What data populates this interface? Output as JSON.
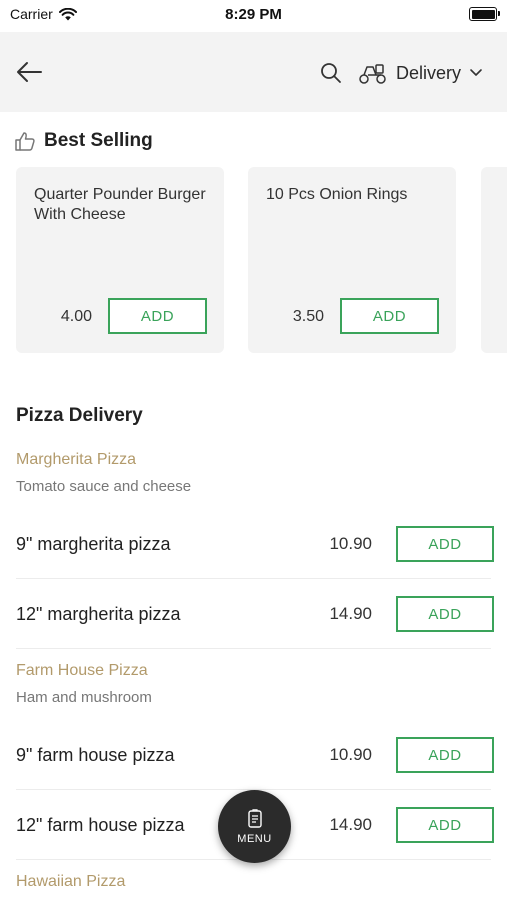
{
  "status_bar": {
    "carrier": "Carrier",
    "time": "8:29 PM"
  },
  "header": {
    "back_icon": "arrow-left-icon",
    "search_icon": "search-icon",
    "delivery_icon": "scooter-icon",
    "delivery_label": "Delivery",
    "chevron_icon": "chevron-down-icon"
  },
  "best_selling": {
    "title": "Best Selling",
    "icon": "thumbs-up-icon",
    "cards": [
      {
        "name": "Quarter Pounder Burger With Cheese",
        "price": "4.00",
        "add_label": "ADD"
      },
      {
        "name": "10 Pcs Onion Rings",
        "price": "3.50",
        "add_label": "ADD"
      }
    ]
  },
  "menu": {
    "section_title": "Pizza Delivery",
    "categories": [
      {
        "title": "Margherita Pizza",
        "description": "Tomato sauce and cheese",
        "items": [
          {
            "name": "9\" margherita pizza",
            "price": "10.90",
            "add_label": "ADD"
          },
          {
            "name": "12\" margherita pizza",
            "price": "14.90",
            "add_label": "ADD"
          }
        ]
      },
      {
        "title": "Farm House Pizza",
        "description": "Ham and mushroom",
        "items": [
          {
            "name": "9\" farm house pizza",
            "price": "10.90",
            "add_label": "ADD"
          },
          {
            "name": "12\" farm house pizza",
            "price": "14.90",
            "add_label": "ADD"
          }
        ]
      },
      {
        "title": "Hawaiian Pizza"
      }
    ]
  },
  "fab": {
    "label": "MENU",
    "icon": "menu-book-icon"
  },
  "colors": {
    "accent": "#3aa35a",
    "category": "#b29a6b",
    "header_bg": "#f3f3f3",
    "fab_bg": "#2b2b2b"
  }
}
